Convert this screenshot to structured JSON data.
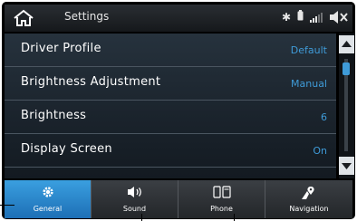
{
  "header": {
    "title": "Settings",
    "bluetooth_icon": "bluetooth-icon",
    "battery_icon": "phone-battery-icon",
    "signal_icon": "signal-icon",
    "mute_icon": "speaker-mute-icon"
  },
  "settings": [
    {
      "label": "Driver Profile",
      "value": "Default"
    },
    {
      "label": "Brightness Adjustment",
      "value": "Manual"
    },
    {
      "label": "Brightness",
      "value": "6"
    },
    {
      "label": "Display Screen",
      "value": "On"
    }
  ],
  "tabs": [
    {
      "label": "General",
      "icon": "gear-icon",
      "active": true
    },
    {
      "label": "Sound",
      "icon": "speaker-icon",
      "active": false
    },
    {
      "label": "Phone",
      "icon": "phone-icon",
      "active": false
    },
    {
      "label": "Navigation",
      "icon": "navigation-icon",
      "active": false
    }
  ],
  "colors": {
    "accent": "#3f9bd8",
    "active_tab": "#2a8ad0",
    "text": "#ffffff"
  }
}
